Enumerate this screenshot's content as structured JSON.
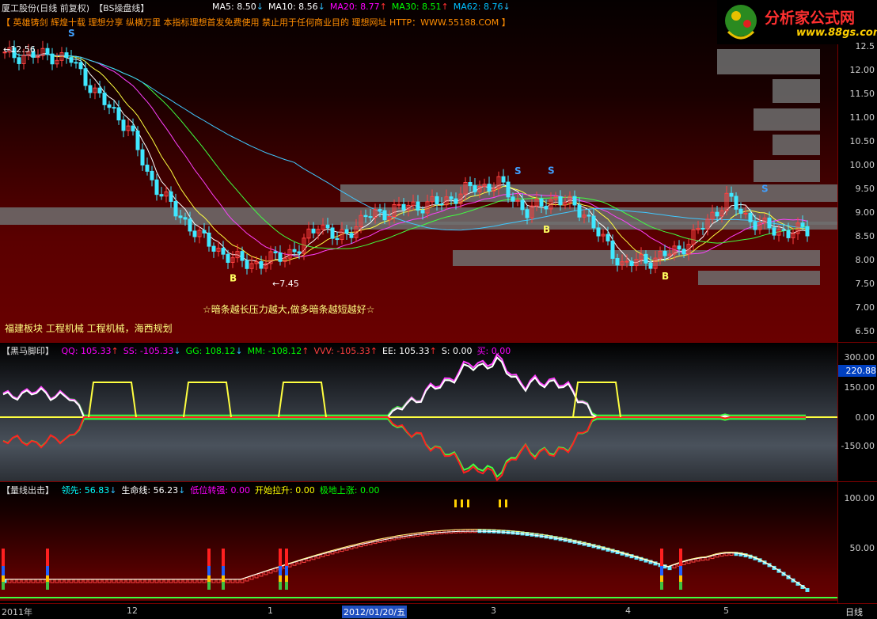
{
  "title_bar": {
    "stock": "厦工股份(日线 前复权)",
    "indicator": "【BS操盘线】",
    "ma": [
      {
        "label": "MA5: 8.50",
        "arrow": "↓",
        "color": "#ffffff"
      },
      {
        "label": "MA10: 8.56",
        "arrow": "↓",
        "color": "#ffffff"
      },
      {
        "label": "MA20: 8.77",
        "arrow": "↑",
        "color": "#ff00ff"
      },
      {
        "label": "MA30: 8.51",
        "arrow": "↑",
        "color": "#00ff00"
      },
      {
        "label": "MA62: 8.76",
        "arrow": "↓",
        "color": "#00c0ff"
      }
    ]
  },
  "banner": "【 英雄铸剑 辉煌十载 理想分享 纵横万里 本指标理想首发免费使用 禁止用于任何商业目的 理想网址 HTTP：WWW.55188.COM 】",
  "logo": {
    "main": "分析家公式网",
    "sub": "www.88gs.com"
  },
  "main_chart": {
    "price_high_label": "12.56",
    "price_low_label": "7.45",
    "slogan": "☆暗条越长压力越大,做多暗条越短越好☆",
    "sector": "福建板块  工程机械  工程机械，海西规划",
    "signals": [
      "S",
      "B",
      "S",
      "S",
      "B",
      "B",
      "S"
    ],
    "y_ticks": [
      "12.5",
      "12.00",
      "11.50",
      "11.00",
      "10.50",
      "10.00",
      "9.50",
      "9.00",
      "8.50",
      "8.00",
      "7.50",
      "7.00",
      "6.50"
    ]
  },
  "panel2": {
    "name": "【黑马脚印】",
    "items": [
      {
        "label": "QQ: 105.33",
        "arrow": "↑",
        "color": "#ff00ff"
      },
      {
        "label": "SS: -105.33",
        "arrow": "↓",
        "color": "#ff00ff"
      },
      {
        "label": "GG: 108.12",
        "arrow": "↓",
        "color": "#00ff00"
      },
      {
        "label": "MM: -108.12",
        "arrow": "↑",
        "color": "#00ff00"
      },
      {
        "label": "VVV: -105.33",
        "arrow": "↑",
        "color": "#ff4040"
      },
      {
        "label": "EE: 105.33",
        "arrow": "↑",
        "color": "#ffffff"
      },
      {
        "label": "S: 0.00",
        "arrow": "",
        "color": "#ffffff"
      },
      {
        "label": "买: 0.00",
        "arrow": "",
        "color": "#ff00ff"
      }
    ],
    "current_value": "220.88",
    "y_ticks": [
      "300.00",
      "150.00",
      "0.00",
      "-150.00"
    ]
  },
  "panel3": {
    "name": "【量线出击】",
    "items": [
      {
        "label": "领先: 56.83",
        "arrow": "↓",
        "color": "#00ffff"
      },
      {
        "label": "生命线: 56.23",
        "arrow": "↓",
        "color": "#ffffff"
      },
      {
        "label": "低位转强: 0.00",
        "arrow": "",
        "color": "#ff00ff"
      },
      {
        "label": "开始拉升: 0.00",
        "arrow": "",
        "color": "#ffff00"
      },
      {
        "label": "极地上涨: 0.00",
        "arrow": "",
        "color": "#00ff00"
      }
    ],
    "y_ticks": [
      "100.00",
      "50.00"
    ]
  },
  "x_axis": {
    "labels": [
      "2011年",
      "12",
      "1",
      "2012/01/20/五",
      "3",
      "4",
      "5"
    ],
    "period": "日线"
  }
}
